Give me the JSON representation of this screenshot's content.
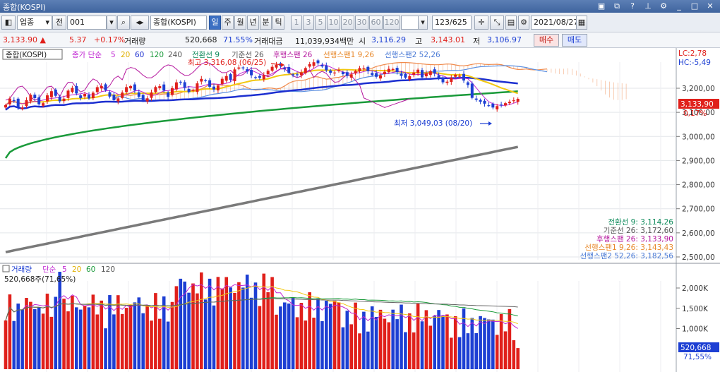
{
  "window": {
    "title": "종합(KOSPI)",
    "controls": [
      "pin-icon",
      "restore-icon",
      "help-icon",
      "tools-icon",
      "settings-icon",
      "minimize-icon",
      "maximize-icon",
      "close-icon"
    ]
  },
  "toolbar": {
    "market_select": "업종",
    "prev_label": "전",
    "code_value": "001",
    "name_value": "종합(KOSPI)",
    "period_tabs": [
      "일",
      "주",
      "월",
      "년",
      "분",
      "틱"
    ],
    "active_period": "일",
    "minute_options": [
      "1",
      "3",
      "5",
      "10",
      "20",
      "30",
      "60",
      "120"
    ],
    "count_value": "123",
    "count_total": "/625",
    "date_value": "2021/08/27"
  },
  "quote": {
    "price": "3,133.90",
    "change": "5.37",
    "change_pct": "+0.17%",
    "volume_label": "거래량",
    "volume_value": "520,668",
    "volume_pct": "71.55%",
    "amount_label": "거래대금",
    "amount_value": "11,039,934백만",
    "open_label": "시",
    "open_value": "3,116.29",
    "high_label": "고",
    "high_value": "3,143.01",
    "low_label": "저",
    "low_value": "3,106.97",
    "buy_label": "매수",
    "sell_label": "매도"
  },
  "price_panel": {
    "legend": {
      "name": "종합(KOSPI)",
      "ma_prefix": "종가 단순",
      "ma_periods": [
        "5",
        "20",
        "60",
        "120",
        "240"
      ],
      "ichimoku": [
        "전환선 9",
        "기준선 26",
        "후행스팬 26",
        "선행스팬1 9,26",
        "선행스팬2 52,26"
      ]
    },
    "corner": {
      "lc": "LC:2,78",
      "hc": "HC:-5,49"
    },
    "max_label": "최고 3,316,08 (06/25)",
    "min_label": "최저 3,049,03 (08/20)",
    "y_ticks": [
      "3,200,00",
      "3,100,00",
      "3,000,00",
      "2,900,00",
      "2,800,00",
      "2,700,00",
      "2,600,00",
      "2,500,00"
    ],
    "current_price_tag": "3,133,90",
    "current_pct": "0,17%",
    "indicator_values": [
      {
        "text": "전환선 9: 3,114,26",
        "color": "#0d8a5a"
      },
      {
        "text": "기준선 26: 3,172,60",
        "color": "#555555"
      },
      {
        "text": "후행스팬 26: 3,133,90",
        "color": "#b5179e"
      },
      {
        "text": "선행스팬1 9,26: 3,143,43",
        "color": "#e8892b"
      },
      {
        "text": "선행스팬2 52,26: 3,182,56",
        "color": "#4b7bd6"
      }
    ]
  },
  "volume_panel": {
    "legend": {
      "name": "거래량",
      "ma_prefix": "단순",
      "ma_periods": [
        "5",
        "20",
        "60",
        "120"
      ]
    },
    "current_text": "520,668주(71,65%)",
    "y_ticks": [
      "2,000K",
      "1,500K",
      "1,000K"
    ],
    "last_tag": "520,668",
    "last_pct": "71,55%"
  },
  "colors": {
    "up": "#e0201b",
    "down": "#1d3fd3",
    "ma5": "#c026d3",
    "ma20": "#f2c811",
    "ma60": "#1c2fd0",
    "ma120": "#1a9a3a",
    "ma240": "#7a7a7a",
    "span1": "#f08a4b",
    "span2": "#5b8fe0"
  }
}
